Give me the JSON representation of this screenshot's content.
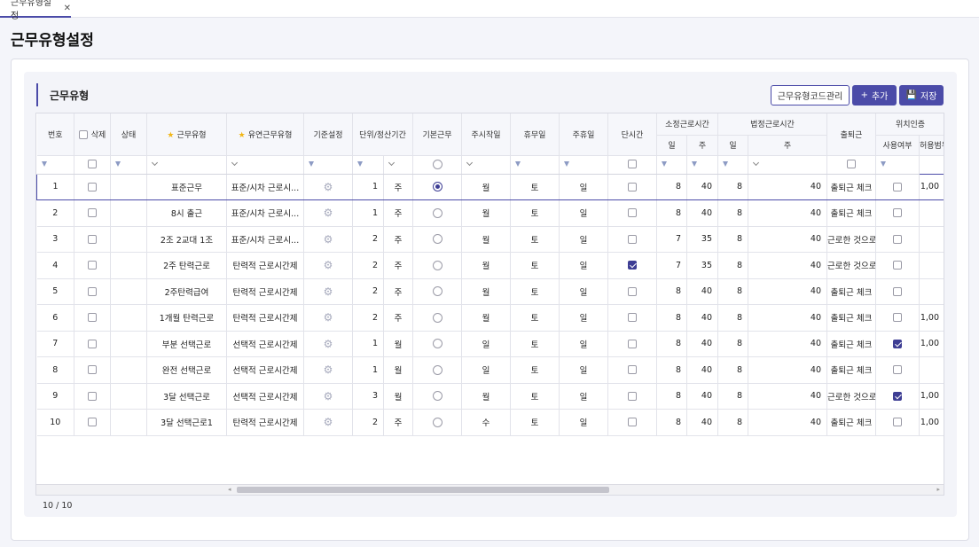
{
  "tab": {
    "label": "근무유형설정",
    "close": "✕"
  },
  "page_title": "근무유형설정",
  "section_title": "근무유형",
  "toolbar": {
    "code_manage": "근무유형코드관리",
    "add": "추가",
    "add_icon": "+",
    "save": "저장",
    "save_icon": "💾"
  },
  "columns": {
    "no": "번호",
    "delete": "삭제",
    "status": "상태",
    "type": "근무유형",
    "flex_type": "유연근무유형",
    "base_setting": "기준설정",
    "unit_period": "단위/정산기간",
    "basic_work": "기본근무",
    "week_start": "주시작일",
    "holiday": "휴무일",
    "weekly_off": "주휴일",
    "short_time": "단시간",
    "prescribed": "소정근로시간",
    "legal": "법정근로시간",
    "day": "일",
    "week": "주",
    "commute": "출퇴근",
    "location": "위치인증",
    "use_yn": "사용여부",
    "range": "허용범위"
  },
  "rows": [
    {
      "no": "1",
      "type": "표준근무",
      "flex": "표준/시차 근로시...",
      "unit": "1",
      "period": "주",
      "basic": true,
      "week_start": "월",
      "holiday": "토",
      "weekly_off": "일",
      "short": false,
      "p_day": "8",
      "p_week": "40",
      "l_day": "8",
      "l_week": "40",
      "commute": "출퇴근 체크",
      "loc": false,
      "range": "1,00"
    },
    {
      "no": "2",
      "type": "8시 출근",
      "flex": "표준/시차 근로시...",
      "unit": "1",
      "period": "주",
      "basic": false,
      "week_start": "월",
      "holiday": "토",
      "weekly_off": "일",
      "short": false,
      "p_day": "8",
      "p_week": "40",
      "l_day": "8",
      "l_week": "40",
      "commute": "출퇴근 체크",
      "loc": false,
      "range": ""
    },
    {
      "no": "3",
      "type": "2조 2교대 1조",
      "flex": "표준/시차 근로시...",
      "unit": "2",
      "period": "주",
      "basic": false,
      "week_start": "월",
      "holiday": "토",
      "weekly_off": "일",
      "short": false,
      "p_day": "7",
      "p_week": "35",
      "l_day": "8",
      "l_week": "40",
      "commute": "근로한 것으로 간주",
      "loc": false,
      "range": ""
    },
    {
      "no": "4",
      "type": "2주 탄력근로",
      "flex": "탄력적 근로시간제",
      "unit": "2",
      "period": "주",
      "basic": false,
      "week_start": "월",
      "holiday": "토",
      "weekly_off": "일",
      "short": true,
      "p_day": "7",
      "p_week": "35",
      "l_day": "8",
      "l_week": "40",
      "commute": "근로한 것으로 간주",
      "loc": false,
      "range": ""
    },
    {
      "no": "5",
      "type": "2주탄력급여",
      "flex": "탄력적 근로시간제",
      "unit": "2",
      "period": "주",
      "basic": false,
      "week_start": "월",
      "holiday": "토",
      "weekly_off": "일",
      "short": false,
      "p_day": "8",
      "p_week": "40",
      "l_day": "8",
      "l_week": "40",
      "commute": "출퇴근 체크",
      "loc": false,
      "range": ""
    },
    {
      "no": "6",
      "type": "1개월 탄력근로",
      "flex": "탄력적 근로시간제",
      "unit": "2",
      "period": "주",
      "basic": false,
      "week_start": "월",
      "holiday": "토",
      "weekly_off": "일",
      "short": false,
      "p_day": "8",
      "p_week": "40",
      "l_day": "8",
      "l_week": "40",
      "commute": "출퇴근 체크",
      "loc": false,
      "range": "1,00"
    },
    {
      "no": "7",
      "type": "부분 선택근로",
      "flex": "선택적 근로시간제",
      "unit": "1",
      "period": "월",
      "basic": false,
      "week_start": "일",
      "holiday": "토",
      "weekly_off": "일",
      "short": false,
      "p_day": "8",
      "p_week": "40",
      "l_day": "8",
      "l_week": "40",
      "commute": "출퇴근 체크",
      "loc": true,
      "range": "1,00"
    },
    {
      "no": "8",
      "type": "완전 선택근로",
      "flex": "선택적 근로시간제",
      "unit": "1",
      "period": "월",
      "basic": false,
      "week_start": "일",
      "holiday": "토",
      "weekly_off": "일",
      "short": false,
      "p_day": "8",
      "p_week": "40",
      "l_day": "8",
      "l_week": "40",
      "commute": "출퇴근 체크",
      "loc": false,
      "range": ""
    },
    {
      "no": "9",
      "type": "3달 선택근로",
      "flex": "선택적 근로시간제",
      "unit": "3",
      "period": "월",
      "basic": false,
      "week_start": "월",
      "holiday": "토",
      "weekly_off": "일",
      "short": false,
      "p_day": "8",
      "p_week": "40",
      "l_day": "8",
      "l_week": "40",
      "commute": "근로한 것으로 간주",
      "loc": true,
      "range": "1,00"
    },
    {
      "no": "10",
      "type": "3달 선택근로1",
      "flex": "탄력적 근로시간제",
      "unit": "2",
      "period": "주",
      "basic": false,
      "week_start": "수",
      "holiday": "토",
      "weekly_off": "일",
      "short": false,
      "p_day": "8",
      "p_week": "40",
      "l_day": "8",
      "l_week": "40",
      "commute": "출퇴근 체크",
      "loc": false,
      "range": "1,00"
    }
  ],
  "footer": {
    "count": "10 / 10"
  },
  "colors": {
    "accent": "#4b4ba8",
    "star": "#f1b617"
  }
}
